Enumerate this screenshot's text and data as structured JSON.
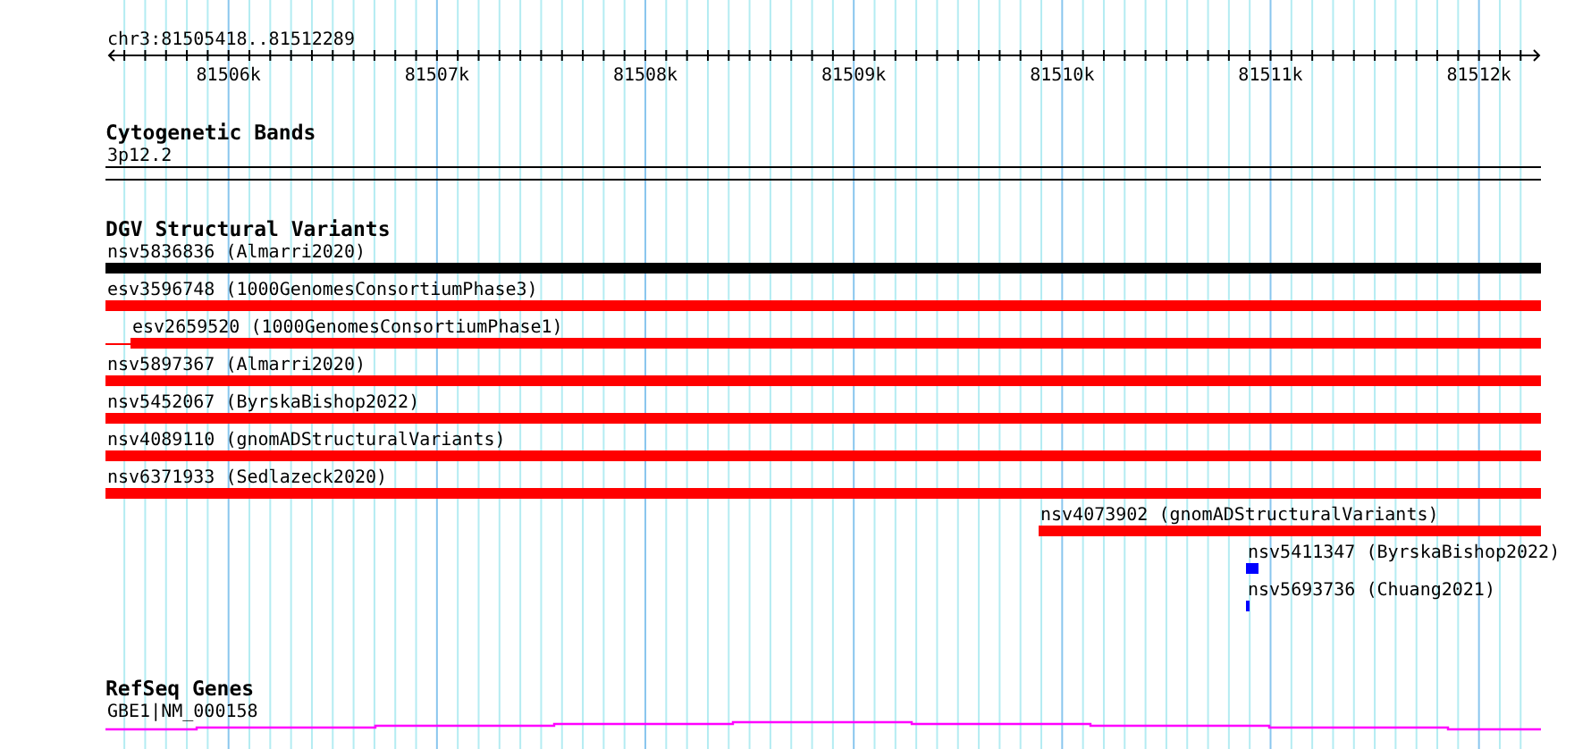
{
  "ruler": {
    "location": "chr3:81505418..81512289",
    "tick_labels": [
      "81506k",
      "81507k",
      "81508k",
      "81509k",
      "81510k",
      "81511k",
      "81512k"
    ]
  },
  "tracks": [
    {
      "kind": "bands",
      "title": "Cytogenetic Bands",
      "features": [
        {
          "label": "3p12.2"
        }
      ]
    },
    {
      "kind": "variants",
      "title": "DGV Structural Variants",
      "features": [
        {
          "label": "nsv5836836 (Almarri2020)",
          "color": "#000000"
        },
        {
          "label": "esv3596748 (1000GenomesConsortiumPhase3)",
          "color": "#ff0000"
        },
        {
          "label": "esv2659520 (1000GenomesConsortiumPhase1)",
          "color": "#ff0000"
        },
        {
          "label": "nsv5897367 (Almarri2020)",
          "color": "#ff0000"
        },
        {
          "label": "nsv5452067 (ByrskaBishop2022)",
          "color": "#ff0000"
        },
        {
          "label": "nsv4089110 (gnomADStructuralVariants)",
          "color": "#ff0000"
        },
        {
          "label": "nsv6371933 (Sedlazeck2020)",
          "color": "#ff0000"
        },
        {
          "label": "nsv4073902 (gnomADStructuralVariants)",
          "color": "#ff0000"
        },
        {
          "label": "nsv5411347 (ByrskaBishop2022)",
          "color": "#0000ff"
        },
        {
          "label": "nsv5693736 (Chuang2021)",
          "color": "#0000ff"
        }
      ]
    },
    {
      "kind": "genes",
      "title": "RefSeq Genes",
      "features": [
        {
          "label": "GBE1|NM_000158"
        }
      ]
    }
  ]
}
